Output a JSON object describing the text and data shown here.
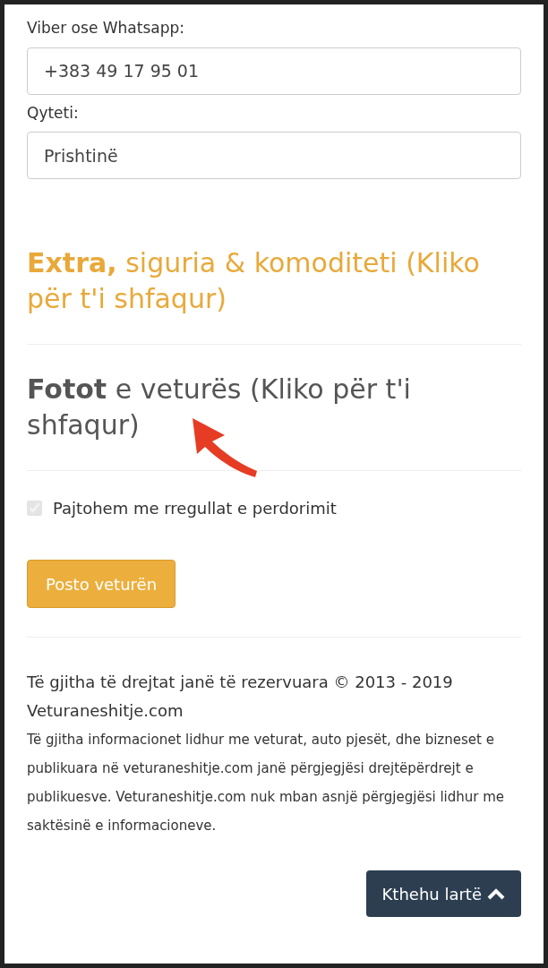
{
  "fields": [
    {
      "label": "Viber ose Whatsapp:",
      "value": "+383 49 17 95 01"
    },
    {
      "label": "Qyteti:",
      "value": "Prishtinë"
    }
  ],
  "sections": [
    {
      "kind": "accent",
      "title": "**Extra,** siguria & komoditeti (Kliko për t'i shfaqur)"
    },
    {
      "kind": "plain",
      "title": "**Fotot** e veturës (Kliko për t'i shfaqur)"
    }
  ],
  "terms": {
    "label": "Pajtohem me rregullat e perdorimit",
    "checked": true,
    "disabled": true
  },
  "submit_button": "Posto veturën",
  "footer": {
    "copyright": "Të gjitha të drejtat janë të rezervuara © 2013 - 2019 Veturaneshitje.com",
    "disclaimer": "Të gjitha informacionet lidhur me veturat, auto pjesët, dhe bizneset e publikuara në veturaneshitje.com janë përgjegjësi drejtëpërdrejt e publikuesve. Veturaneshitje.com nuk mban asnjë përgjegjësi lidhur me saktësinë e informacioneve."
  },
  "back_to_top": "Kthehu lartë"
}
